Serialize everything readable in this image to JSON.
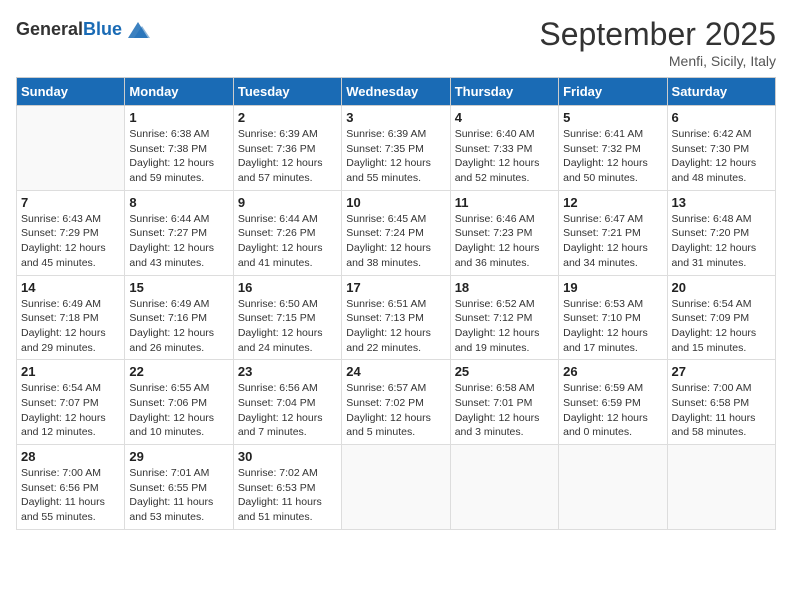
{
  "header": {
    "logo_general": "General",
    "logo_blue": "Blue",
    "month_title": "September 2025",
    "location": "Menfi, Sicily, Italy"
  },
  "days_of_week": [
    "Sunday",
    "Monday",
    "Tuesday",
    "Wednesday",
    "Thursday",
    "Friday",
    "Saturday"
  ],
  "weeks": [
    [
      {
        "day": "",
        "sunrise": "",
        "sunset": "",
        "daylight": ""
      },
      {
        "day": "1",
        "sunrise": "Sunrise: 6:38 AM",
        "sunset": "Sunset: 7:38 PM",
        "daylight": "Daylight: 12 hours and 59 minutes."
      },
      {
        "day": "2",
        "sunrise": "Sunrise: 6:39 AM",
        "sunset": "Sunset: 7:36 PM",
        "daylight": "Daylight: 12 hours and 57 minutes."
      },
      {
        "day": "3",
        "sunrise": "Sunrise: 6:39 AM",
        "sunset": "Sunset: 7:35 PM",
        "daylight": "Daylight: 12 hours and 55 minutes."
      },
      {
        "day": "4",
        "sunrise": "Sunrise: 6:40 AM",
        "sunset": "Sunset: 7:33 PM",
        "daylight": "Daylight: 12 hours and 52 minutes."
      },
      {
        "day": "5",
        "sunrise": "Sunrise: 6:41 AM",
        "sunset": "Sunset: 7:32 PM",
        "daylight": "Daylight: 12 hours and 50 minutes."
      },
      {
        "day": "6",
        "sunrise": "Sunrise: 6:42 AM",
        "sunset": "Sunset: 7:30 PM",
        "daylight": "Daylight: 12 hours and 48 minutes."
      }
    ],
    [
      {
        "day": "7",
        "sunrise": "Sunrise: 6:43 AM",
        "sunset": "Sunset: 7:29 PM",
        "daylight": "Daylight: 12 hours and 45 minutes."
      },
      {
        "day": "8",
        "sunrise": "Sunrise: 6:44 AM",
        "sunset": "Sunset: 7:27 PM",
        "daylight": "Daylight: 12 hours and 43 minutes."
      },
      {
        "day": "9",
        "sunrise": "Sunrise: 6:44 AM",
        "sunset": "Sunset: 7:26 PM",
        "daylight": "Daylight: 12 hours and 41 minutes."
      },
      {
        "day": "10",
        "sunrise": "Sunrise: 6:45 AM",
        "sunset": "Sunset: 7:24 PM",
        "daylight": "Daylight: 12 hours and 38 minutes."
      },
      {
        "day": "11",
        "sunrise": "Sunrise: 6:46 AM",
        "sunset": "Sunset: 7:23 PM",
        "daylight": "Daylight: 12 hours and 36 minutes."
      },
      {
        "day": "12",
        "sunrise": "Sunrise: 6:47 AM",
        "sunset": "Sunset: 7:21 PM",
        "daylight": "Daylight: 12 hours and 34 minutes."
      },
      {
        "day": "13",
        "sunrise": "Sunrise: 6:48 AM",
        "sunset": "Sunset: 7:20 PM",
        "daylight": "Daylight: 12 hours and 31 minutes."
      }
    ],
    [
      {
        "day": "14",
        "sunrise": "Sunrise: 6:49 AM",
        "sunset": "Sunset: 7:18 PM",
        "daylight": "Daylight: 12 hours and 29 minutes."
      },
      {
        "day": "15",
        "sunrise": "Sunrise: 6:49 AM",
        "sunset": "Sunset: 7:16 PM",
        "daylight": "Daylight: 12 hours and 26 minutes."
      },
      {
        "day": "16",
        "sunrise": "Sunrise: 6:50 AM",
        "sunset": "Sunset: 7:15 PM",
        "daylight": "Daylight: 12 hours and 24 minutes."
      },
      {
        "day": "17",
        "sunrise": "Sunrise: 6:51 AM",
        "sunset": "Sunset: 7:13 PM",
        "daylight": "Daylight: 12 hours and 22 minutes."
      },
      {
        "day": "18",
        "sunrise": "Sunrise: 6:52 AM",
        "sunset": "Sunset: 7:12 PM",
        "daylight": "Daylight: 12 hours and 19 minutes."
      },
      {
        "day": "19",
        "sunrise": "Sunrise: 6:53 AM",
        "sunset": "Sunset: 7:10 PM",
        "daylight": "Daylight: 12 hours and 17 minutes."
      },
      {
        "day": "20",
        "sunrise": "Sunrise: 6:54 AM",
        "sunset": "Sunset: 7:09 PM",
        "daylight": "Daylight: 12 hours and 15 minutes."
      }
    ],
    [
      {
        "day": "21",
        "sunrise": "Sunrise: 6:54 AM",
        "sunset": "Sunset: 7:07 PM",
        "daylight": "Daylight: 12 hours and 12 minutes."
      },
      {
        "day": "22",
        "sunrise": "Sunrise: 6:55 AM",
        "sunset": "Sunset: 7:06 PM",
        "daylight": "Daylight: 12 hours and 10 minutes."
      },
      {
        "day": "23",
        "sunrise": "Sunrise: 6:56 AM",
        "sunset": "Sunset: 7:04 PM",
        "daylight": "Daylight: 12 hours and 7 minutes."
      },
      {
        "day": "24",
        "sunrise": "Sunrise: 6:57 AM",
        "sunset": "Sunset: 7:02 PM",
        "daylight": "Daylight: 12 hours and 5 minutes."
      },
      {
        "day": "25",
        "sunrise": "Sunrise: 6:58 AM",
        "sunset": "Sunset: 7:01 PM",
        "daylight": "Daylight: 12 hours and 3 minutes."
      },
      {
        "day": "26",
        "sunrise": "Sunrise: 6:59 AM",
        "sunset": "Sunset: 6:59 PM",
        "daylight": "Daylight: 12 hours and 0 minutes."
      },
      {
        "day": "27",
        "sunrise": "Sunrise: 7:00 AM",
        "sunset": "Sunset: 6:58 PM",
        "daylight": "Daylight: 11 hours and 58 minutes."
      }
    ],
    [
      {
        "day": "28",
        "sunrise": "Sunrise: 7:00 AM",
        "sunset": "Sunset: 6:56 PM",
        "daylight": "Daylight: 11 hours and 55 minutes."
      },
      {
        "day": "29",
        "sunrise": "Sunrise: 7:01 AM",
        "sunset": "Sunset: 6:55 PM",
        "daylight": "Daylight: 11 hours and 53 minutes."
      },
      {
        "day": "30",
        "sunrise": "Sunrise: 7:02 AM",
        "sunset": "Sunset: 6:53 PM",
        "daylight": "Daylight: 11 hours and 51 minutes."
      },
      {
        "day": "",
        "sunrise": "",
        "sunset": "",
        "daylight": ""
      },
      {
        "day": "",
        "sunrise": "",
        "sunset": "",
        "daylight": ""
      },
      {
        "day": "",
        "sunrise": "",
        "sunset": "",
        "daylight": ""
      },
      {
        "day": "",
        "sunrise": "",
        "sunset": "",
        "daylight": ""
      }
    ]
  ]
}
